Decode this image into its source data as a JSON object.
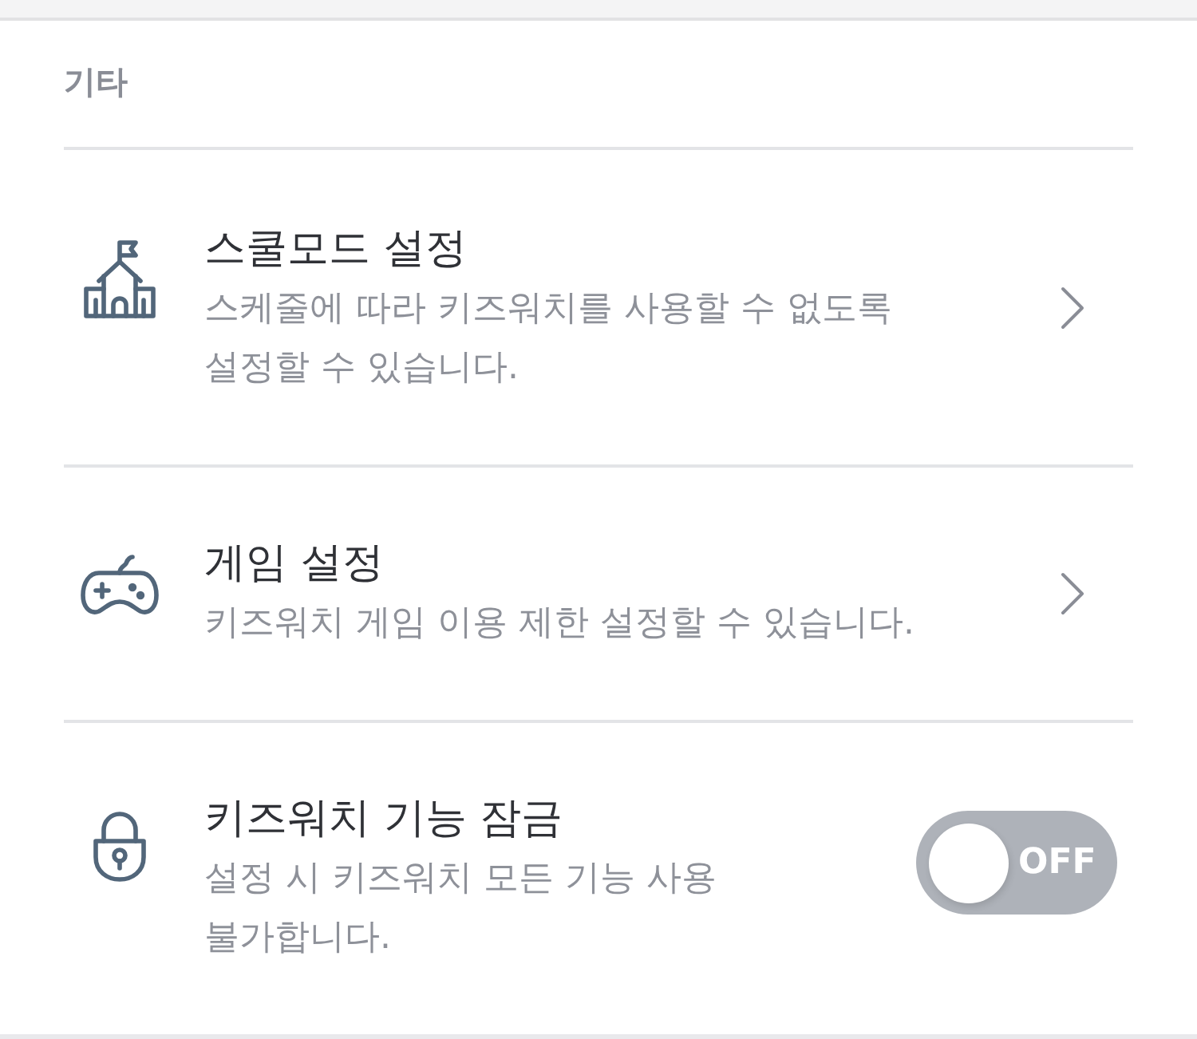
{
  "section": {
    "title": "기타"
  },
  "items": [
    {
      "kind": "link",
      "title": "스쿨모드 설정",
      "description": "스케줄에 따라 키즈워치를 사용할 수 없도록 설정할 수 있습니다."
    },
    {
      "kind": "link",
      "title": "게임 설정",
      "description": "키즈워치 게임 이용 제한 설정할 수 있습니다."
    },
    {
      "kind": "toggle",
      "title": "키즈워치 기능 잠금",
      "description": "설정 시 키즈워치 모든 기능 사용 불가합니다.",
      "toggle": {
        "on": false,
        "label": "OFF"
      }
    }
  ]
}
